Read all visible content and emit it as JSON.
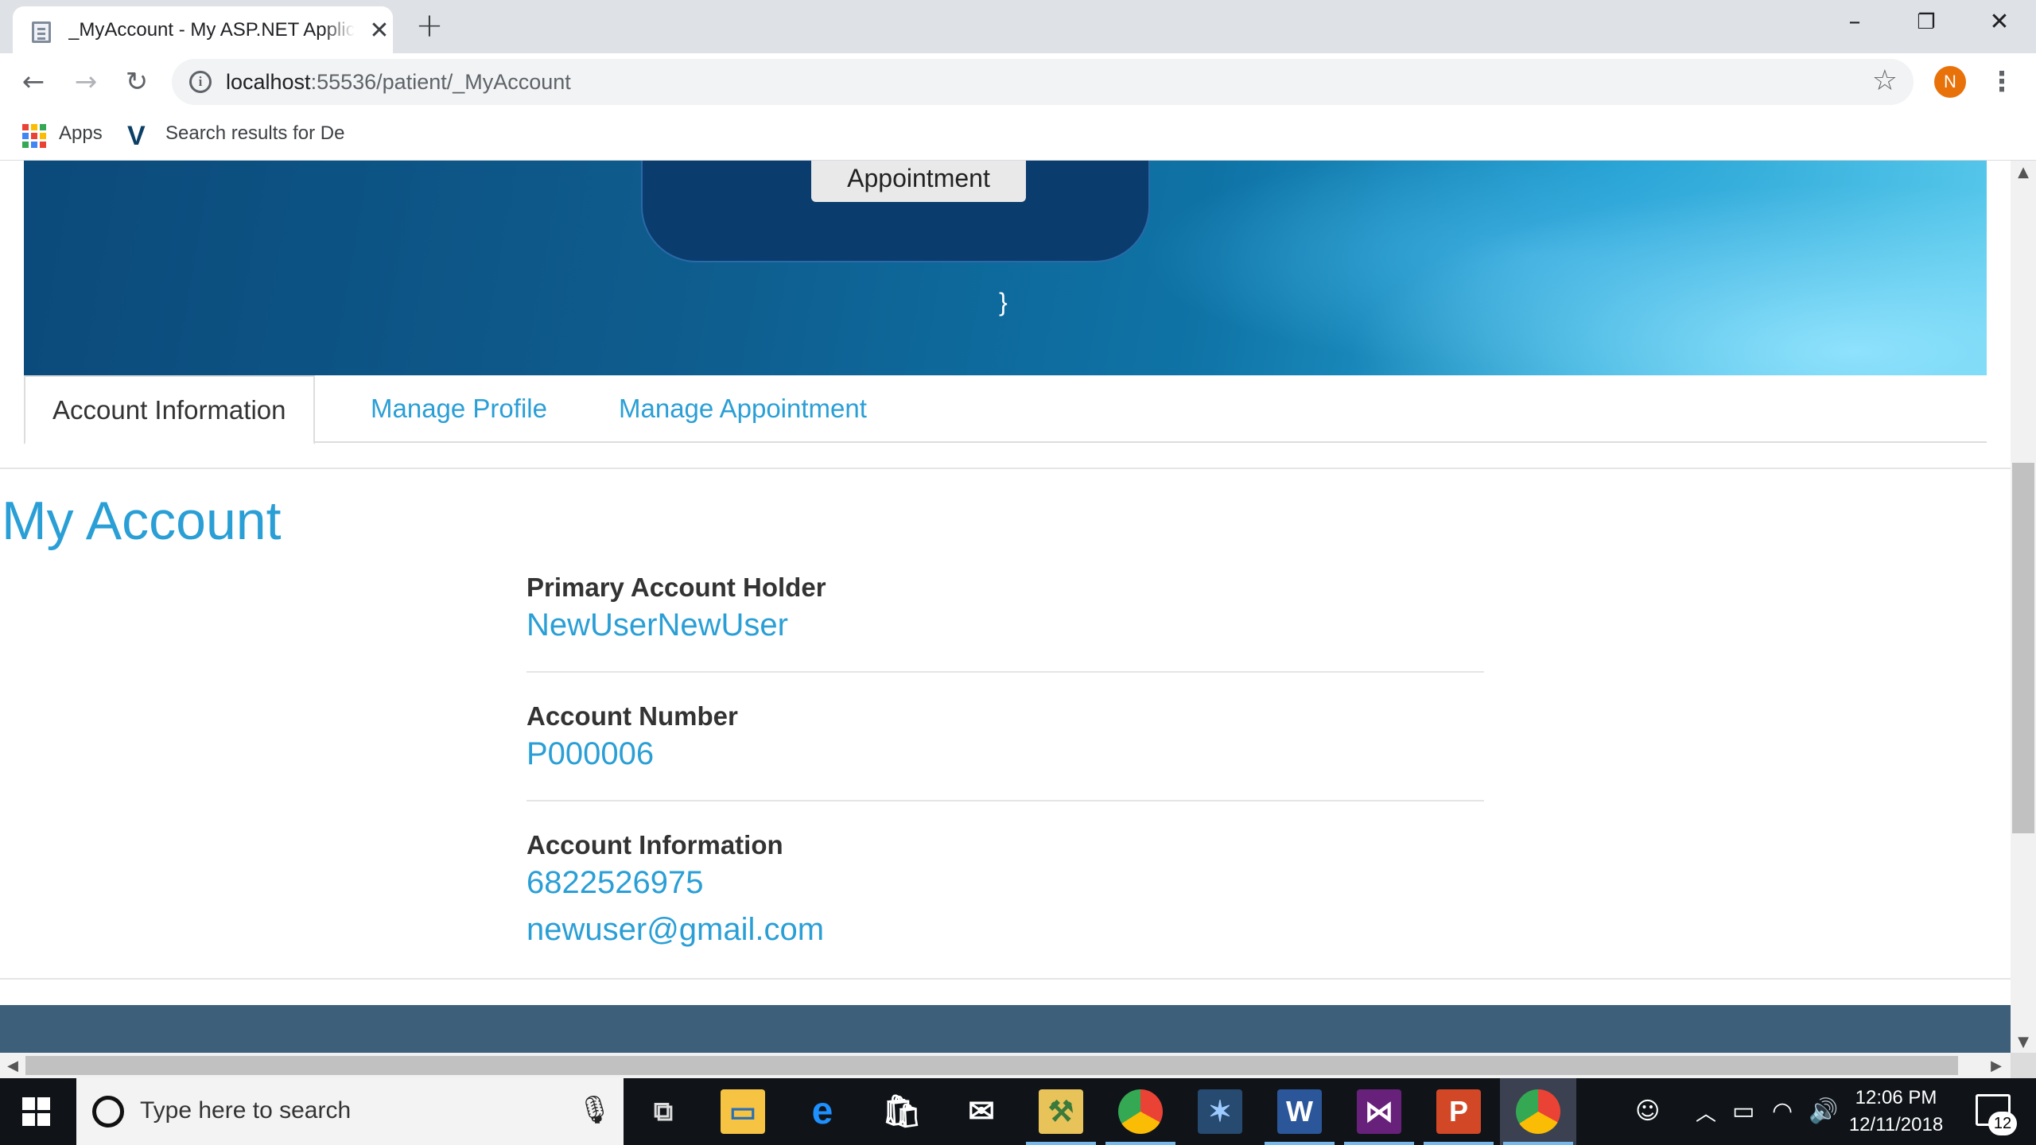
{
  "browser": {
    "tab_title": "_MyAccount - My ASP.NET Application",
    "url_host": "localhost",
    "url_rest": ":55536/patient/_MyAccount",
    "profile_initial": "N",
    "bookmarks": [
      {
        "label": "Apps",
        "icon": "apps-grid-icon"
      },
      {
        "label": "Search results for De",
        "icon": "v-logo-icon"
      }
    ]
  },
  "banner": {
    "appointment_button": "Appointment",
    "stray_text": "}"
  },
  "tabs": [
    {
      "label": "Account Information",
      "active": true
    },
    {
      "label": "Manage Profile",
      "active": false
    },
    {
      "label": "Manage Appointment",
      "active": false
    }
  ],
  "account": {
    "title": "My Account",
    "holder_label": "Primary Account Holder",
    "holder_value": "NewUserNewUser",
    "number_label": "Account Number",
    "number_value": "P000006",
    "info_label": "Account Information",
    "phone": "6822526975",
    "email": "newuser@gmail.com"
  },
  "taskbar": {
    "search_placeholder": "Type here to search",
    "time": "12:06 PM",
    "date": "12/11/2018",
    "notification_count": "12"
  },
  "colors": {
    "link_blue": "#2a9fd6",
    "footer": "#3d5f7a",
    "banner_dark": "#0a3c6e"
  }
}
